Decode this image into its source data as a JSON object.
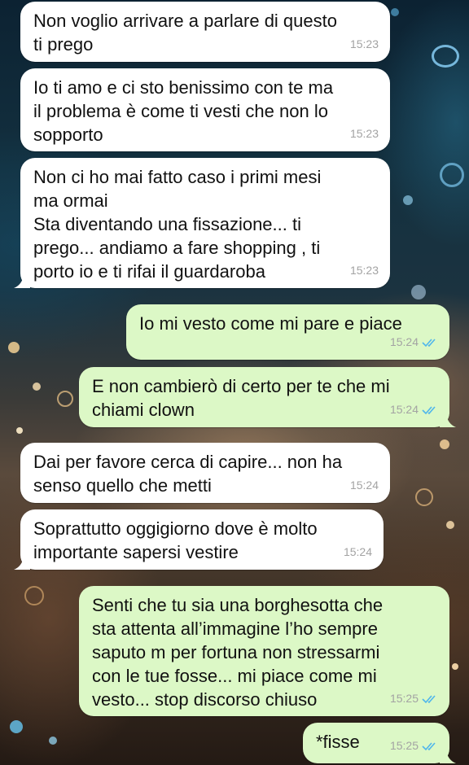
{
  "chat": {
    "messages": [
      {
        "dir": "in",
        "text": "Non voglio arrivare a parlare di questo\nti prego",
        "time": "15:23"
      },
      {
        "dir": "in",
        "text": "Io ti amo e ci sto benissimo con te ma\nil problema è come ti vesti che non lo\nsopporto",
        "time": "15:23"
      },
      {
        "dir": "in",
        "text": "Non ci ho mai fatto caso i primi mesi\nma ormai\nSta diventando una fissazione... ti\nprego... andiamo a fare shopping , ti\nporto io e ti rifai il guardaroba",
        "time": "15:23"
      },
      {
        "dir": "out",
        "text": "Io mi vesto come mi pare e piace",
        "time": "15:24",
        "status": "read"
      },
      {
        "dir": "out",
        "text": "E non cambierò di certo per te che mi\nchiami clown",
        "time": "15:24",
        "status": "read"
      },
      {
        "dir": "in",
        "text": "Dai per favore cerca di capire... non ha\nsenso quello che metti",
        "time": "15:24"
      },
      {
        "dir": "in",
        "text": "Soprattutto oggigiorno dove è molto\nimportante sapersi vestire",
        "time": "15:24"
      },
      {
        "dir": "out",
        "text": "Senti che tu sia una borghesotta che\nsta attenta all’immagine l’ho sempre\nsaputo m per fortuna non stressarmi\ncon le tue fosse... mi piace come mi\nvesto... stop discorso chiuso",
        "time": "15:25",
        "status": "read"
      },
      {
        "dir": "out",
        "text": "*fisse",
        "time": "15:25",
        "status": "read"
      }
    ]
  },
  "colors": {
    "incoming_bubble": "#ffffff",
    "outgoing_bubble": "#dcf8c6",
    "read_ticks": "#4fb6ec",
    "timestamp": "#a3a3a3"
  },
  "icons": {
    "read_status": "double-check-icon"
  }
}
